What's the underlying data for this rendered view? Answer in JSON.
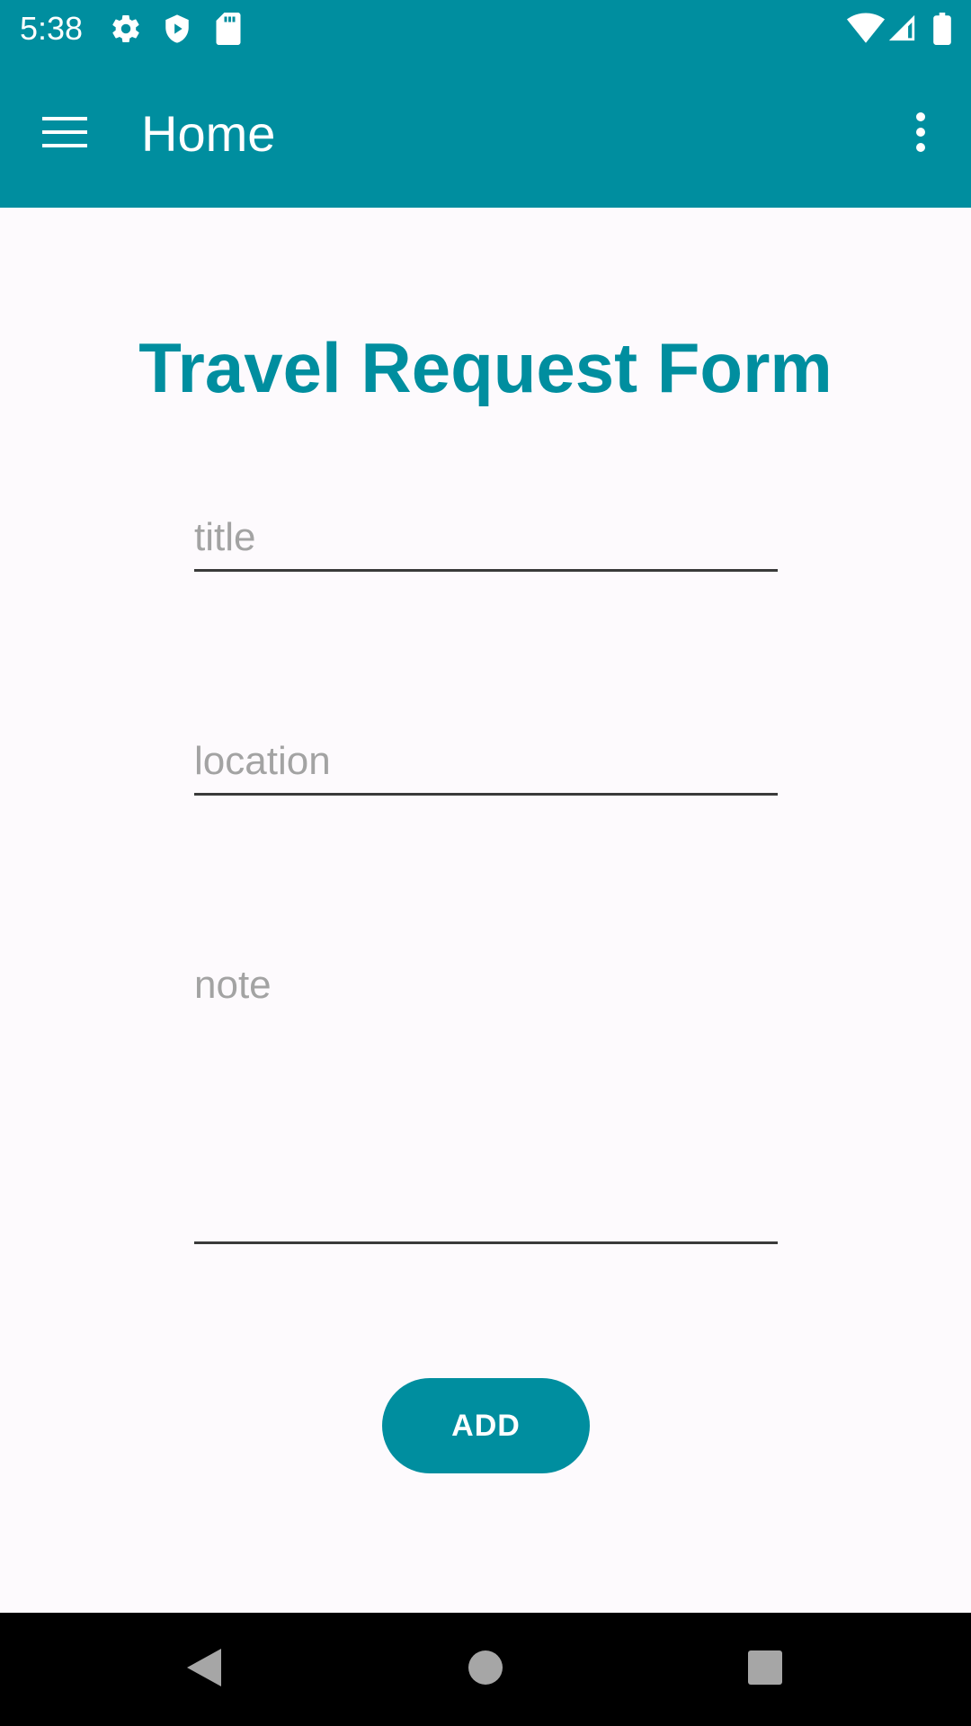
{
  "status_bar": {
    "time": "5:38",
    "icons": [
      "settings-icon",
      "shield-icon",
      "sd-card-icon",
      "wifi-icon",
      "signal-icon",
      "battery-icon"
    ]
  },
  "app_bar": {
    "title": "Home",
    "menu_icon": "hamburger-menu-icon",
    "overflow_icon": "more-vert-icon"
  },
  "form": {
    "heading": "Travel Request Form",
    "fields": [
      {
        "placeholder": "title",
        "value": ""
      },
      {
        "placeholder": "location",
        "value": ""
      },
      {
        "placeholder": "note",
        "value": ""
      }
    ],
    "submit_label": "ADD"
  },
  "nav_bar": {
    "icons": [
      "back-icon",
      "home-icon",
      "recents-icon"
    ]
  },
  "colors": {
    "accent": "#008e9f",
    "background": "#fdfafd",
    "placeholder": "#a3a3a3",
    "underline": "#3a3a3a"
  }
}
